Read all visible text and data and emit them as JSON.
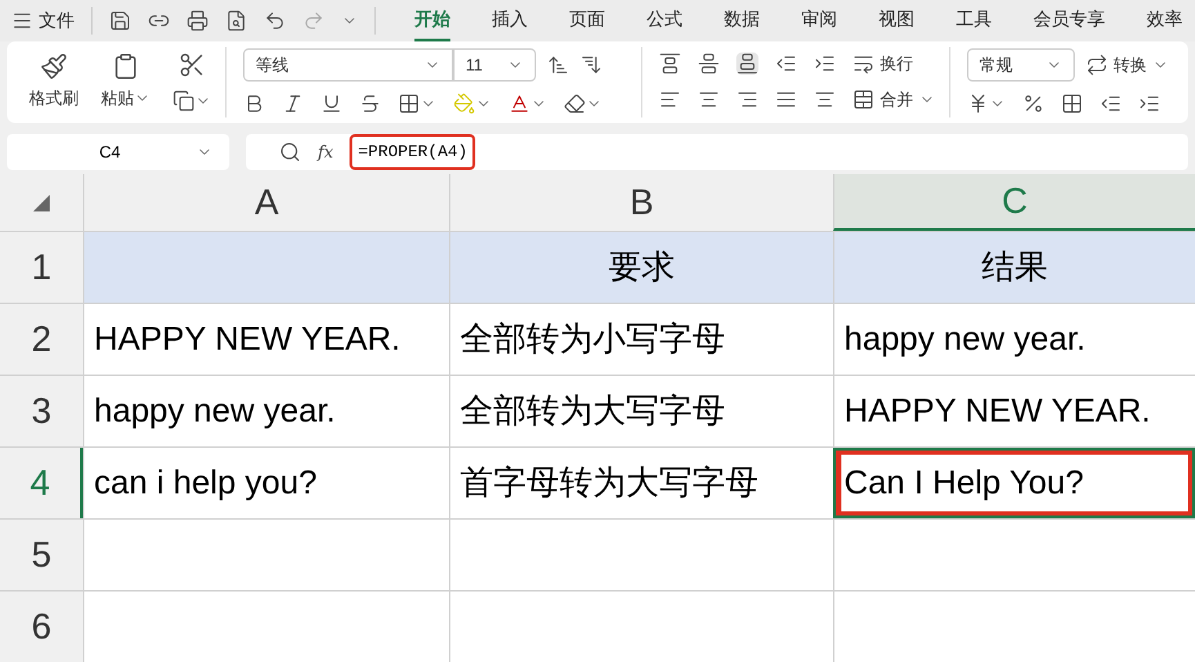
{
  "menu_bar": {
    "menu_label": "文件",
    "tabs": [
      {
        "label": "开始",
        "selected": true
      },
      {
        "label": "插入",
        "selected": false
      },
      {
        "label": "页面",
        "selected": false
      },
      {
        "label": "公式",
        "selected": false
      },
      {
        "label": "数据",
        "selected": false
      },
      {
        "label": "审阅",
        "selected": false
      },
      {
        "label": "视图",
        "selected": false
      },
      {
        "label": "工具",
        "selected": false
      },
      {
        "label": "会员专享",
        "selected": false
      },
      {
        "label": "效率",
        "selected": false
      }
    ]
  },
  "ribbon": {
    "format_painter": "格式刷",
    "paste": "粘贴",
    "font_name": "等线",
    "font_size": "11",
    "wrap": "换行",
    "merge": "合并",
    "number_format": "常规",
    "convert": "转换"
  },
  "formula_bar": {
    "cell_ref": "C4",
    "fx_label": "fx",
    "formula": "=PROPER(A4)",
    "annotated": true
  },
  "sheet": {
    "columns": [
      {
        "label": "A",
        "selected": false
      },
      {
        "label": "B",
        "selected": false
      },
      {
        "label": "C",
        "selected": true
      }
    ],
    "rows": [
      {
        "label": "1",
        "selected": false,
        "header": true,
        "cells": [
          {
            "annotated": false
          },
          {
            "text": "要求",
            "annotated": false
          },
          {
            "text": "结果",
            "annotated": false
          }
        ]
      },
      {
        "label": "2",
        "selected": false,
        "header": false,
        "cells": [
          {
            "text": "HAPPY NEW YEAR.",
            "annotated": false
          },
          {
            "text": "全部转为小写字母",
            "annotated": false
          },
          {
            "text": "happy new year.",
            "annotated": false
          }
        ]
      },
      {
        "label": "3",
        "selected": false,
        "header": false,
        "cells": [
          {
            "text": "happy new year.",
            "annotated": false
          },
          {
            "text": "全部转为大写字母",
            "annotated": false
          },
          {
            "text": "HAPPY NEW YEAR.",
            "annotated": false
          }
        ]
      },
      {
        "label": "4",
        "selected": true,
        "header": false,
        "cells": [
          {
            "text": "can i help you?",
            "annotated": false
          },
          {
            "text": "首字母转为大写字母",
            "annotated": false
          },
          {
            "text": "Can I Help You?",
            "annotated": true
          }
        ]
      },
      {
        "label": "5",
        "selected": false,
        "header": false,
        "cells": [
          {
            "annotated": false
          },
          {
            "annotated": false
          },
          {
            "annotated": false
          }
        ]
      },
      {
        "label": "6",
        "selected": false,
        "header": false,
        "cells": [
          {
            "annotated": false
          },
          {
            "annotated": false
          },
          {
            "annotated": false
          }
        ]
      }
    ]
  }
}
